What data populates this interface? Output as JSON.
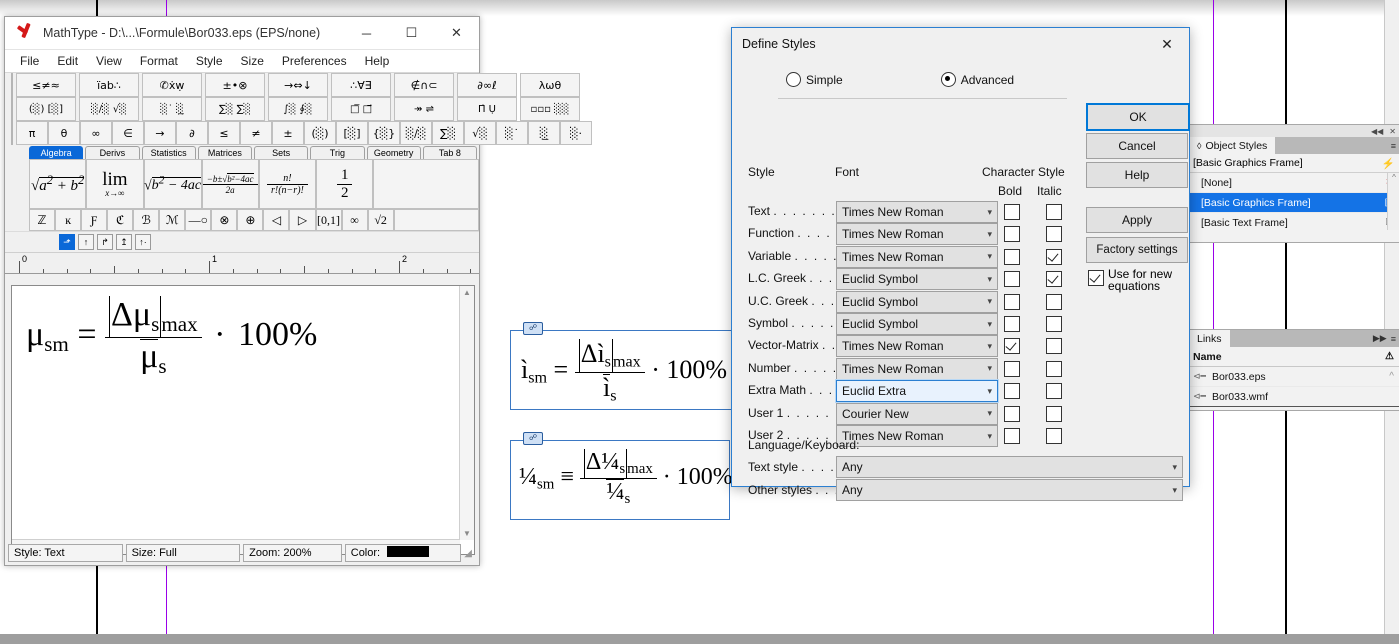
{
  "mathtype": {
    "title": "MathType - D:\\...\\Formule\\Bor033.eps (EPS/none)",
    "window_buttons": {
      "minimize": "─",
      "maximize": "☐",
      "close": "✕"
    },
    "menu": [
      "File",
      "Edit",
      "View",
      "Format",
      "Style",
      "Size",
      "Preferences",
      "Help"
    ],
    "toolbar_row1": [
      "≤≠≈",
      "ı̈ab∴",
      "✆ẋẉ",
      "±•⊗",
      "→⇔↓",
      "∴∀∃",
      "∉∩⊂",
      "∂∞ℓ",
      "λωθ"
    ],
    "toolbar_row2": [
      "(░) [░]",
      "░∕░ √░",
      "░˙ ░̲",
      "∑░ ∑░",
      "∫░ ∮░",
      "□̅ □⃗",
      "↠ ⇌",
      "Π̇ Ụ",
      "▫▫▫ ░░"
    ],
    "toolbar_row3": [
      "π",
      "θ",
      "∞",
      "∈",
      "→",
      "∂",
      "≤",
      "≠",
      "±",
      "(░)",
      "[░]",
      "{░}",
      "░∕░",
      "∑░",
      "√░",
      "░˙",
      "░̲",
      "░·"
    ],
    "tabs": [
      "Algebra",
      "Derivs",
      "Statistics",
      "Matrices",
      "Sets",
      "Trig",
      "Geometry",
      "Tab 8"
    ],
    "active_tab": "Algebra",
    "palette_row1": [
      "√(a²+b²)",
      "lim x→∞",
      "√(b²−4ac)",
      "(−b±√(b²−4ac))/2a",
      "n!/(r!(n−r)!)",
      "1/2"
    ],
    "palette_row2": [
      "ℤ",
      "ĸ",
      "Ƒ",
      "ℭ",
      "ℬ",
      "ℳ",
      "—○",
      "⊗",
      "⊕",
      "◁",
      "▷",
      "[0,1]",
      "∞",
      "√2"
    ],
    "nudge_buttons": [
      "⬏",
      "↑",
      "↱",
      "↥",
      "↑·"
    ],
    "ruler_labels": [
      "0",
      "1",
      "2"
    ],
    "equation": {
      "lhs_base": "μ",
      "lhs_sub": "sm",
      "equals": "=",
      "num_delta": "Δμ",
      "num_sub": "s",
      "num_max": "max",
      "den_base": "μ",
      "den_sub": "s",
      "dot": "·",
      "percent": "100%"
    },
    "status": {
      "style": "Style: Text",
      "size": "Size: Full",
      "zoom": "Zoom: 200%",
      "color_label": "Color:",
      "color_value": "#000000"
    }
  },
  "document_frames": [
    {
      "name": "frame-eps",
      "lhs_base": "ì",
      "lhs_sub": "sm",
      "equals": "=",
      "num_delta": "Δì",
      "num_sub": "s",
      "num_max": "max",
      "den_base": "ì",
      "den_sub": "s",
      "dot": "·",
      "percent": "100%"
    },
    {
      "name": "frame-wmf",
      "lhs_base": "¼",
      "lhs_sub": "sm",
      "equals": "≡",
      "num_delta": "Δ¼",
      "num_sub": "s",
      "num_max": "max",
      "den_base": "¼",
      "den_sub": "s",
      "dot": "·",
      "percent": "100%"
    }
  ],
  "object_styles_panel": {
    "tab_label": "Object Styles",
    "collapse_icon": "◀◀",
    "close_icon": "✕",
    "menu_icon": "≡",
    "current_style": "[Basic Graphics Frame]",
    "lightning_icon": "⚡",
    "items": [
      {
        "label": "[None]",
        "icon": "none-icon",
        "selected": false
      },
      {
        "label": "[Basic Graphics Frame]",
        "icon": "graphics-frame-icon",
        "selected": true
      },
      {
        "label": "[Basic Text Frame]",
        "icon": "text-frame-icon",
        "selected": false
      }
    ]
  },
  "links_panel": {
    "tab_label": "Links",
    "expand_icon": "▶▶",
    "menu_icon": "≡",
    "column_name": "Name",
    "column_status_icon": "⚠",
    "items": [
      {
        "name": "Bor033.eps",
        "icon": "link-icon"
      },
      {
        "name": "Bor033.wmf",
        "icon": "link-icon"
      }
    ]
  },
  "dialog": {
    "title": "Define Styles",
    "close_icon": "✕",
    "modes": [
      {
        "label": "Simple",
        "selected": false
      },
      {
        "label": "Advanced",
        "selected": true
      }
    ],
    "headers": {
      "style": "Style",
      "font": "Font",
      "character_style": "Character Style",
      "bold": "Bold",
      "italic": "Italic"
    },
    "rows": [
      {
        "style": "Text",
        "dots": ". . . . . . . .",
        "font": "Times New Roman",
        "bold": false,
        "italic": false,
        "focused": false
      },
      {
        "style": "Function",
        "dots": ". . . . . .",
        "font": "Times New Roman",
        "bold": false,
        "italic": false,
        "focused": false
      },
      {
        "style": "Variable",
        "dots": ". . . . . .",
        "font": "Times New Roman",
        "bold": false,
        "italic": true,
        "focused": false
      },
      {
        "style": "L.C. Greek",
        "dots": ". . . .",
        "font": "Euclid Symbol",
        "bold": false,
        "italic": true,
        "focused": false
      },
      {
        "style": "U.C. Greek",
        "dots": ". . . .",
        "font": "Euclid Symbol",
        "bold": false,
        "italic": false,
        "focused": false
      },
      {
        "style": "Symbol",
        "dots": ". . . . . . .",
        "font": "Euclid Symbol",
        "bold": false,
        "italic": false,
        "focused": false
      },
      {
        "style": "Vector-Matrix",
        "dots": ". .",
        "font": "Times New Roman",
        "bold": true,
        "italic": false,
        "focused": false
      },
      {
        "style": "Number",
        "dots": ". . . . . .",
        "font": "Times New Roman",
        "bold": false,
        "italic": false,
        "focused": false
      },
      {
        "style": "Extra Math",
        "dots": ". . . .",
        "font": "Euclid Extra",
        "bold": false,
        "italic": false,
        "focused": true
      },
      {
        "style": "User 1",
        "dots": ". . . . . . .",
        "font": "Courier New",
        "bold": false,
        "italic": false,
        "focused": false
      },
      {
        "style": "User 2",
        "dots": ". . . . . . .",
        "font": "Times New Roman",
        "bold": false,
        "italic": false,
        "focused": false
      }
    ],
    "language_section": {
      "heading": "Language/Keyboard:",
      "text_style_label": "Text style",
      "text_style_dots": ". . . . .",
      "text_style_value": "Any",
      "other_styles_label": "Other styles",
      "other_styles_dots": ". . . .",
      "other_styles_value": "Any"
    },
    "buttons": {
      "ok": "OK",
      "cancel": "Cancel",
      "help": "Help",
      "apply": "Apply",
      "factory": "Factory settings"
    },
    "use_for_new": {
      "label_line1": "Use for new",
      "label_line2": "equations",
      "checked": true
    }
  },
  "colors": {
    "accent_blue": "#1473e6",
    "dialog_focus": "#2b7fd1",
    "frame_blue": "#3b78c3",
    "guide_purple": "#9a00e8",
    "tab_active": "#0a68d8"
  }
}
